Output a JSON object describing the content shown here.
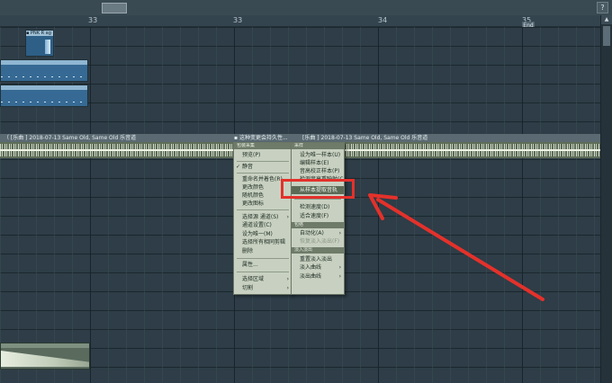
{
  "ruler": {
    "marks": [
      "33",
      "33",
      "34",
      "35"
    ]
  },
  "end_marker": "End",
  "clips": {
    "small_clip_caption": "▪ PNK R  ag"
  },
  "track_header": {
    "left": "（ [乐曲 ]  2018-07-13 Same Old, Same Old 乐音道",
    "middle": "▪ 这种变更会持久性...",
    "right": "[乐曲 ]  2018-07-13 Same Old, Same Old 乐音道"
  },
  "context_menu": {
    "section": "包装采集",
    "items": [
      "预览(P)",
      "静音",
      "重命名并着色(R)",
      "更改颜色",
      "随机颜色",
      "更改图标",
      "选择源 通道(S)",
      "通道设置(C)",
      "设为唯一(M)",
      "选择所有相同剪辑",
      "删除",
      "属性...",
      "选择区域",
      "切割"
    ]
  },
  "submenu": {
    "section1": "采样",
    "items1": [
      "设为唯一样本(U)",
      "编辑样本(E)",
      "音高校正样本(P)",
      "检测音高重映射(C)",
      "从样本提取音轨",
      "检测速度(D)",
      "适合速度(F)"
    ],
    "section2": "包络",
    "items2": [
      "自动化(A)",
      "恢复淡入淡出(F)"
    ],
    "section3": "淡入淡出",
    "items3": [
      "重置淡入淡出",
      "淡入曲线",
      "淡出曲线"
    ]
  },
  "colors": {
    "highlight_box": "#e4312b",
    "arrow": "#e4312b"
  }
}
